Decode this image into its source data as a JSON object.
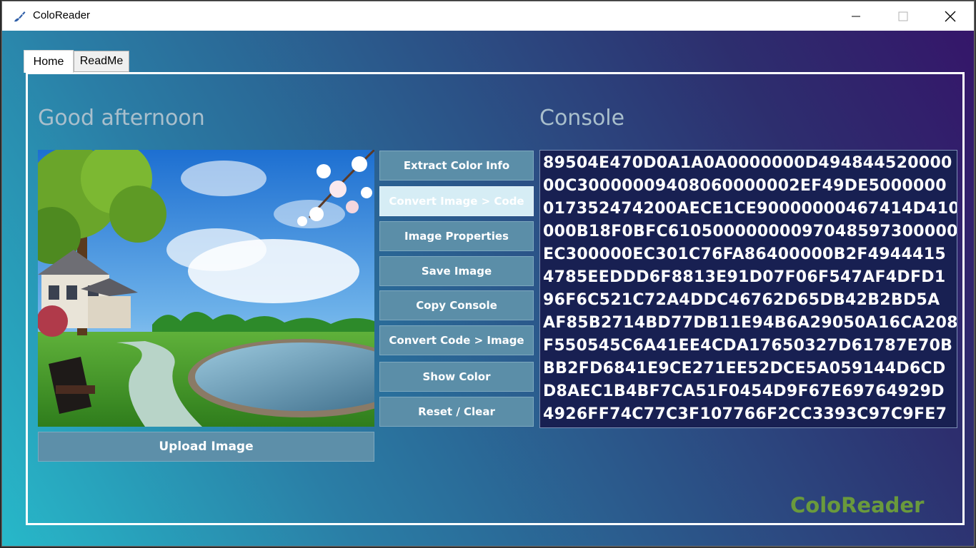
{
  "window": {
    "title": "ColoReader",
    "icon": "brush-icon"
  },
  "tabs": [
    {
      "label": "Home",
      "selected": true
    },
    {
      "label": "ReadMe",
      "selected": false
    }
  ],
  "home": {
    "greeting": "Good afternoon",
    "console_title": "Console",
    "upload_label": "Upload Image",
    "buttons": [
      {
        "label": "Extract Color Info"
      },
      {
        "label": "Convert Image > Code",
        "active": true
      },
      {
        "label": "Image Properties"
      },
      {
        "label": "Save Image"
      },
      {
        "label": "Copy Console"
      },
      {
        "label": "Convert Code > Image"
      },
      {
        "label": "Show Color"
      },
      {
        "label": "Reset / Clear"
      }
    ],
    "console_lines": [
      "89504E470D0A1A0A0000000D494844520000",
      "00C30000009408060000002EF49DE5000000",
      "017352474200AECE1CE90000000467414D410",
      "000B18F0BFC61050000000097048597300000",
      "EC300000EC301C76FA86400000B2F4944415",
      "4785EEDDD6F8813E91D07F06F547AF4DFD1",
      "96F6C521C72A4DDC46762D65DB42B2BD5A",
      "AF85B2714BD77DB11E94B6A29050A16CA208",
      "F550545C6A41EE4CDA17650327D61787E70B",
      "BB2FD6841E9CE271EE52DCE5A059144D6CD",
      "D8AEC1B4BF7CA51F0454D9F67E69764929D",
      "4926FF74C77C3F107766F2CC3393C97C9FE7"
    ],
    "brand": "ColoReader"
  },
  "colors": {
    "brand_green": "#6a9a3c",
    "console_bg": "#182052",
    "button_bg": "#5b8ea8"
  }
}
